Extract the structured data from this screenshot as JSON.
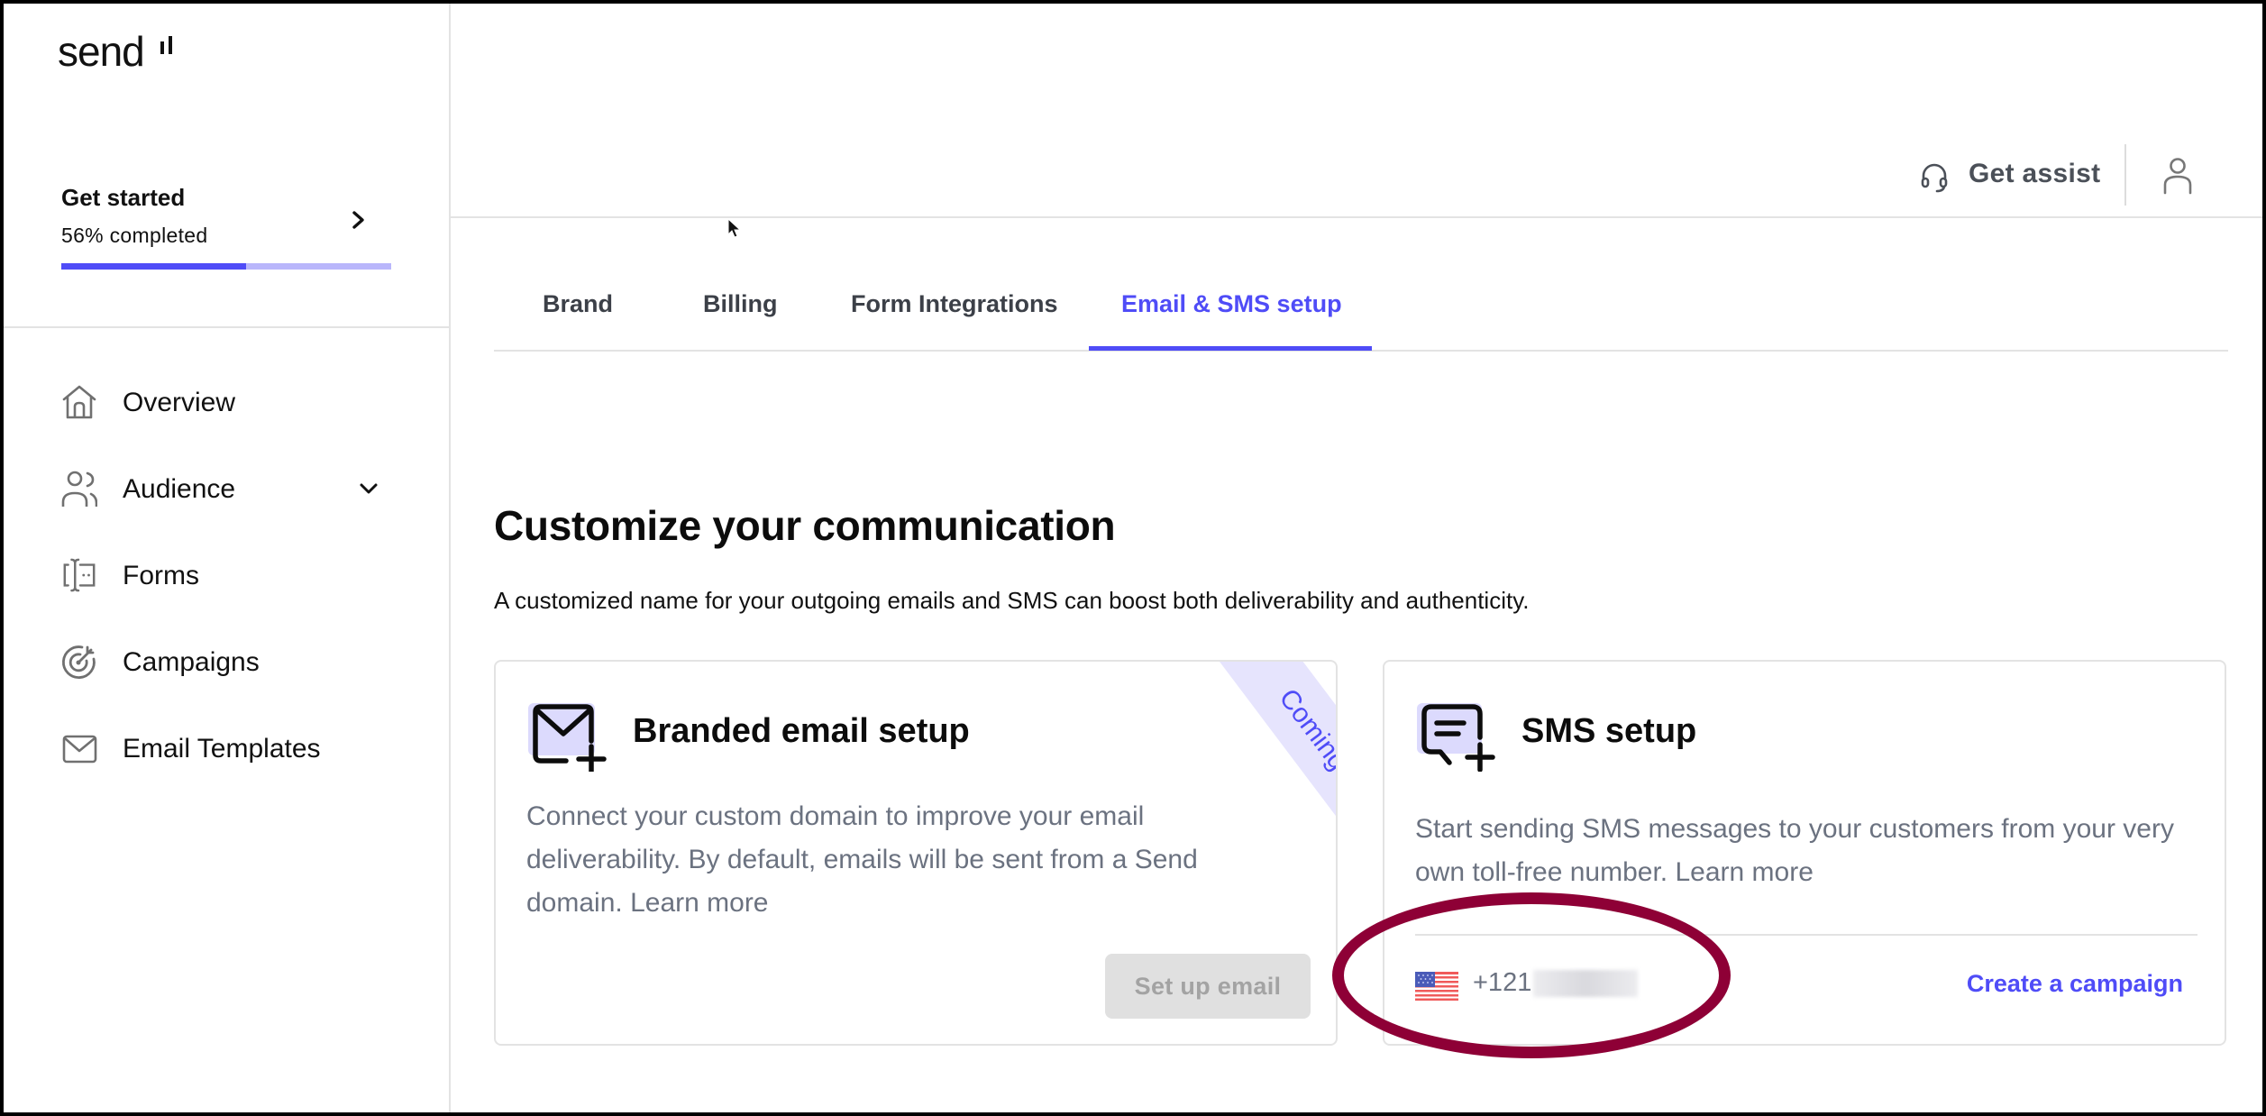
{
  "app": {
    "logo_text": "send"
  },
  "sidebar": {
    "get_started": {
      "title": "Get started",
      "progress_label": "56% completed",
      "progress_fraction": 0.56
    },
    "items": [
      {
        "label": "Overview",
        "icon": "home-icon"
      },
      {
        "label": "Audience",
        "icon": "users-icon",
        "expandable": true
      },
      {
        "label": "Forms",
        "icon": "form-icon"
      },
      {
        "label": "Campaigns",
        "icon": "target-icon"
      },
      {
        "label": "Email Templates",
        "icon": "mail-icon"
      }
    ]
  },
  "header": {
    "assist_label": "Get assist",
    "assist_icon": "headset-icon",
    "user_icon": "user-icon"
  },
  "tabs": [
    {
      "label": "Brand",
      "active": false
    },
    {
      "label": "Billing",
      "active": false
    },
    {
      "label": "Form Integrations",
      "active": false
    },
    {
      "label": "Email & SMS setup",
      "active": true
    }
  ],
  "main": {
    "title": "Customize your communication",
    "subtitle": "A customized name for your outgoing emails and SMS can boost both deliverability and authenticity.",
    "cards": {
      "email": {
        "title": "Branded email setup",
        "description": "Connect your custom domain to improve your email deliverability. By default, emails will be sent from a Send domain.",
        "learn_more": "Learn more",
        "ribbon": "Coming Soon",
        "button_label": "Set up email",
        "button_disabled": true
      },
      "sms": {
        "title": "SMS setup",
        "description": "Start sending SMS messages to your customers from your very own toll-free number.",
        "learn_more": "Learn more",
        "phone_visible": "+121",
        "phone_country": "US",
        "link_label": "Create a campaign"
      }
    }
  },
  "colors": {
    "accent": "#4f4cf7",
    "accent_light": "#b9b6fb",
    "ribbon_bg": "#e6e4fd",
    "annotation": "#8e0036",
    "muted_text": "#6b7280"
  }
}
